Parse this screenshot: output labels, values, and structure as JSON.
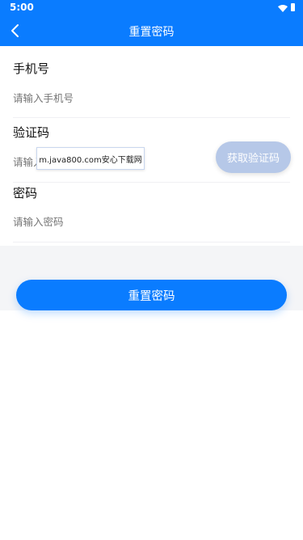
{
  "status_bar": {
    "time": "5:00"
  },
  "app_bar": {
    "title": "重置密码"
  },
  "form": {
    "phone": {
      "label": "手机号",
      "placeholder": "请输入手机号"
    },
    "code": {
      "label": "验证码",
      "placeholder": "请输入验证码",
      "button_label": "获取验证码"
    },
    "password": {
      "label": "密码",
      "placeholder": "请输入密码"
    }
  },
  "submit_button": {
    "label": "重置密码"
  },
  "watermark": {
    "text": "m.java800.com安心下载网"
  },
  "colors": {
    "primary": "#0a7cff",
    "code_button_disabled": "#b6c8e8",
    "gray_area": "#f4f5f7"
  },
  "icons": {
    "back": "chevron-left-icon",
    "wifi": "wifi-icon",
    "battery": "battery-icon"
  }
}
